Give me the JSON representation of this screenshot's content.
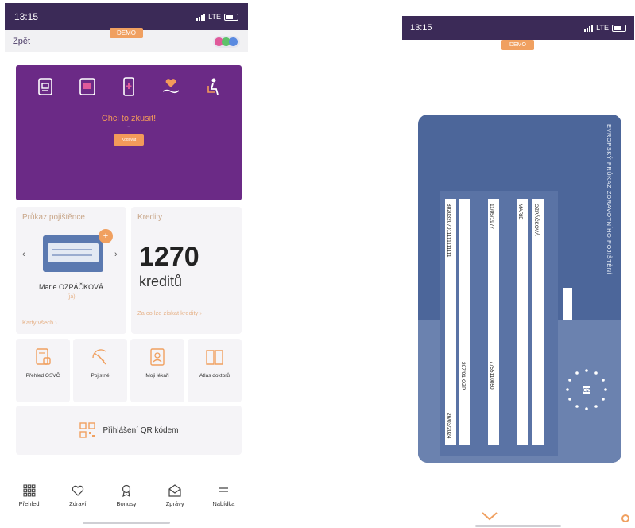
{
  "left": {
    "status": {
      "time": "13:15",
      "network": "LTE"
    },
    "nav": {
      "back": "Zpět",
      "demo": "DEMO"
    },
    "banner": {
      "cta_title": "Chci to zkusit!",
      "cta_sub": "...",
      "cta_button": "Kódovat"
    },
    "insurance": {
      "title": "Průkaz pojištěnce",
      "holder": "Marie OZPÁČKOVÁ",
      "holder_sub": "(já)",
      "link": "Karty všech"
    },
    "credits": {
      "title": "Kredity",
      "value": "1270",
      "unit": "kreditů",
      "link": "Za co lze získat kredity"
    },
    "tiles": [
      {
        "label": "Přehled OSVČ"
      },
      {
        "label": "Pojistné"
      },
      {
        "label": "Moji lékaři"
      },
      {
        "label": "Atlas doktorů"
      }
    ],
    "qr": {
      "label": "Přihlášení QR kódem"
    },
    "tabbar": [
      {
        "label": "Přehled"
      },
      {
        "label": "Zdraví"
      },
      {
        "label": "Bonusy"
      },
      {
        "label": "Zprávy"
      },
      {
        "label": "Nabídka"
      }
    ]
  },
  "right": {
    "status": {
      "time": "13:15",
      "network": "LTE"
    },
    "demo": "DEMO",
    "card": {
      "title": "EVROPSKÝ PRŮKAZ ZDRAVOTNÍHO POJIŠTĚNÍ",
      "surname": "OZPÁČKOVÁ",
      "given": "MARIE",
      "birth": "11/05/1977",
      "number_id": "7755110050",
      "card_number": "80203207011111111111",
      "institution": "207/01-OZP",
      "expiry": "26/03/2024"
    }
  },
  "colors": {
    "primary": "#3b2a57",
    "banner": "#6b2a86",
    "accent": "#f0a060",
    "card": "#4c669a"
  }
}
